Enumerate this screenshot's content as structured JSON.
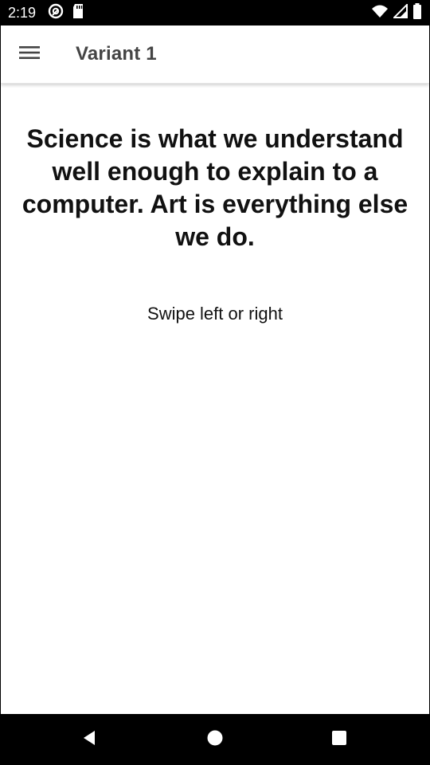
{
  "status_bar": {
    "time": "2:19",
    "left_icons": [
      "sync-icon",
      "sd-card-icon"
    ],
    "right_icons": [
      "wifi-icon",
      "signal-icon",
      "battery-icon"
    ]
  },
  "toolbar": {
    "menu_icon": "hamburger-menu-icon",
    "title": "Variant 1"
  },
  "content": {
    "quote": "Science is what we understand well enough to explain to a computer. Art is everything else we do.",
    "hint": "Swipe left or right"
  },
  "nav_bar": {
    "buttons": [
      "back-icon",
      "home-icon",
      "recents-icon"
    ]
  },
  "colors": {
    "status_bar_bg": "#000000",
    "app_bg": "#ffffff",
    "title_text": "#444444",
    "body_text": "#111111"
  }
}
